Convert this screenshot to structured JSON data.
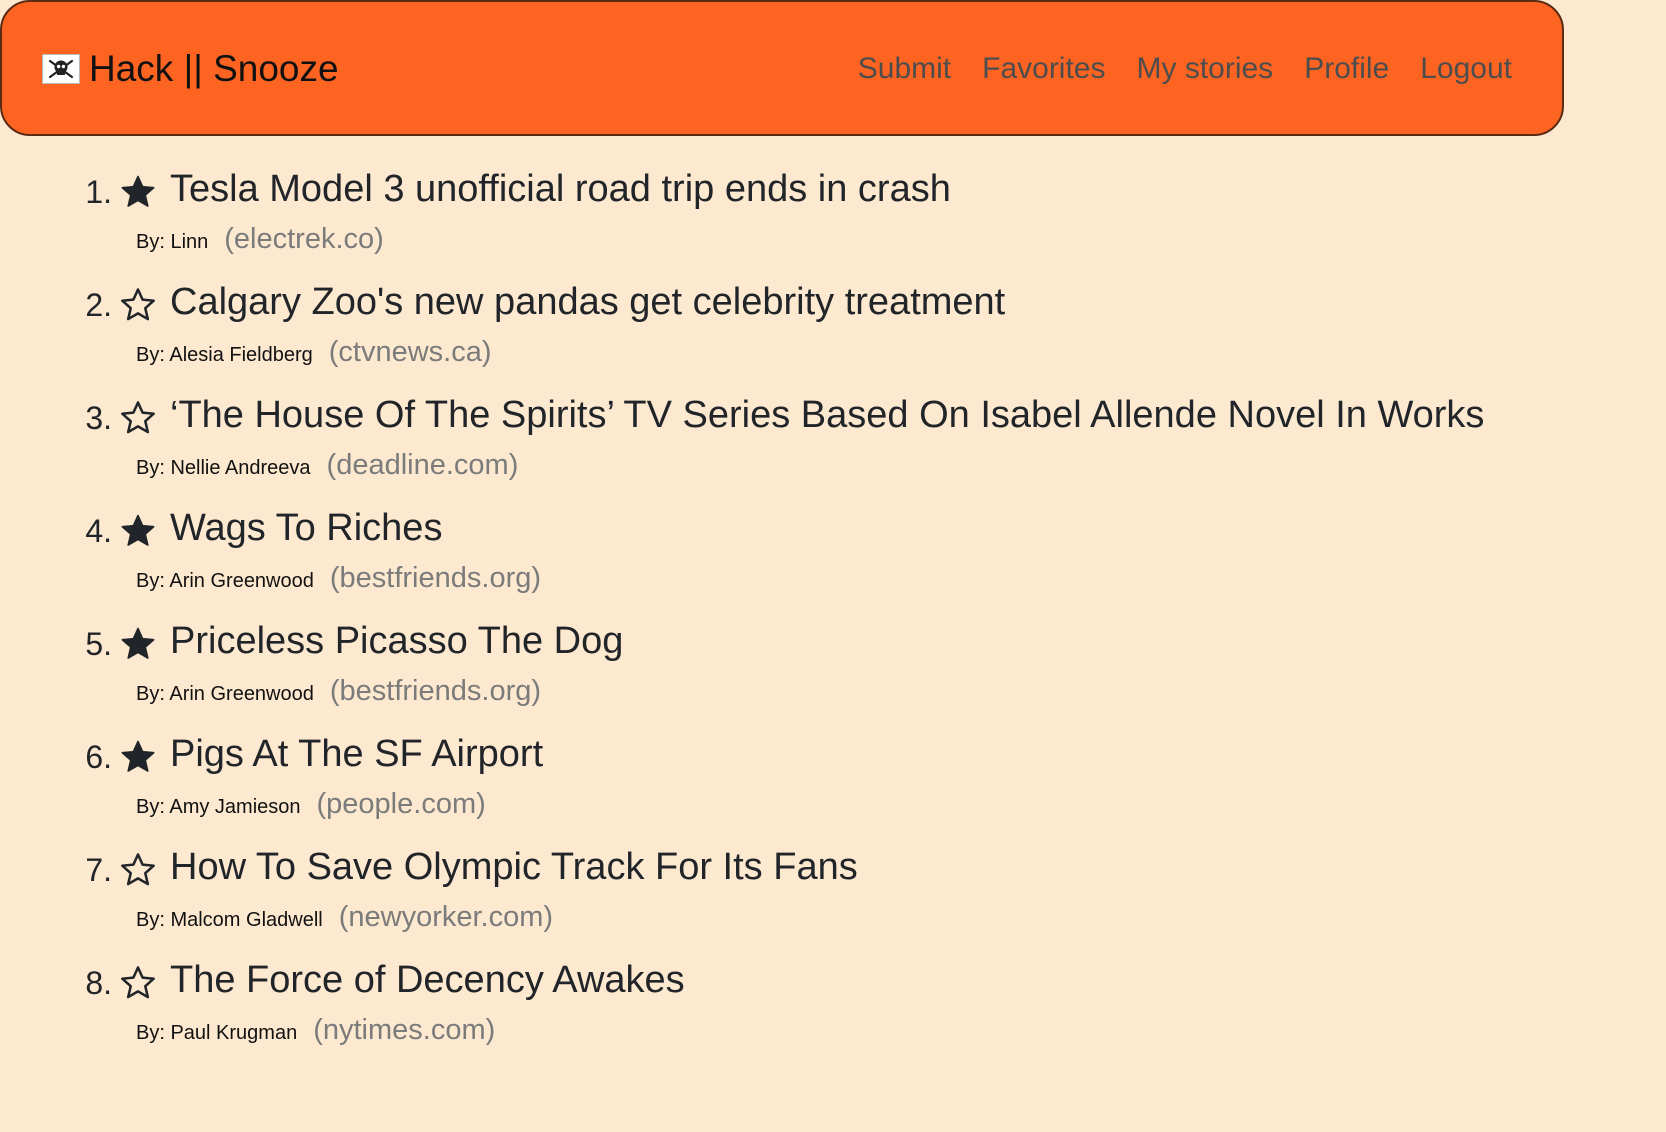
{
  "nav": {
    "brand": "Hack || Snooze",
    "links": [
      "Submit",
      "Favorites",
      "My stories",
      "Profile",
      "Logout"
    ]
  },
  "stories": [
    {
      "num": "1.",
      "favorited": true,
      "title": "Tesla Model 3 unofficial road trip ends in crash",
      "author": "By: Linn",
      "host": "(electrek.co)"
    },
    {
      "num": "2.",
      "favorited": false,
      "title": "Calgary Zoo's new pandas get celebrity treatment",
      "author": "By: Alesia Fieldberg",
      "host": "(ctvnews.ca)"
    },
    {
      "num": "3.",
      "favorited": false,
      "title": "‘The House Of The Spirits’ TV Series Based On Isabel Allende Novel In Works",
      "author": "By: Nellie Andreeva",
      "host": "(deadline.com)"
    },
    {
      "num": "4.",
      "favorited": true,
      "title": "Wags To Riches",
      "author": "By: Arin Greenwood",
      "host": "(bestfriends.org)"
    },
    {
      "num": "5.",
      "favorited": true,
      "title": "Priceless Picasso The Dog",
      "author": "By: Arin Greenwood",
      "host": "(bestfriends.org)"
    },
    {
      "num": "6.",
      "favorited": true,
      "title": "Pigs At The SF Airport",
      "author": "By: Amy Jamieson",
      "host": "(people.com)"
    },
    {
      "num": "7.",
      "favorited": false,
      "title": "How To Save Olympic Track For Its Fans",
      "author": "By: Malcom Gladwell",
      "host": "(newyorker.com)"
    },
    {
      "num": "8.",
      "favorited": false,
      "title": "The Force of Decency Awakes",
      "author": "By: Paul Krugman",
      "host": "(nytimes.com)"
    }
  ],
  "colors": {
    "navbar": "#fd6421",
    "background": "#fde9cf",
    "nav_link": "#4d4d4d",
    "hostname": "#7b7b7b"
  },
  "icons": {
    "brand": "pirate-flag-icon",
    "favorite_on": "star-filled-icon",
    "favorite_off": "star-outline-icon"
  }
}
